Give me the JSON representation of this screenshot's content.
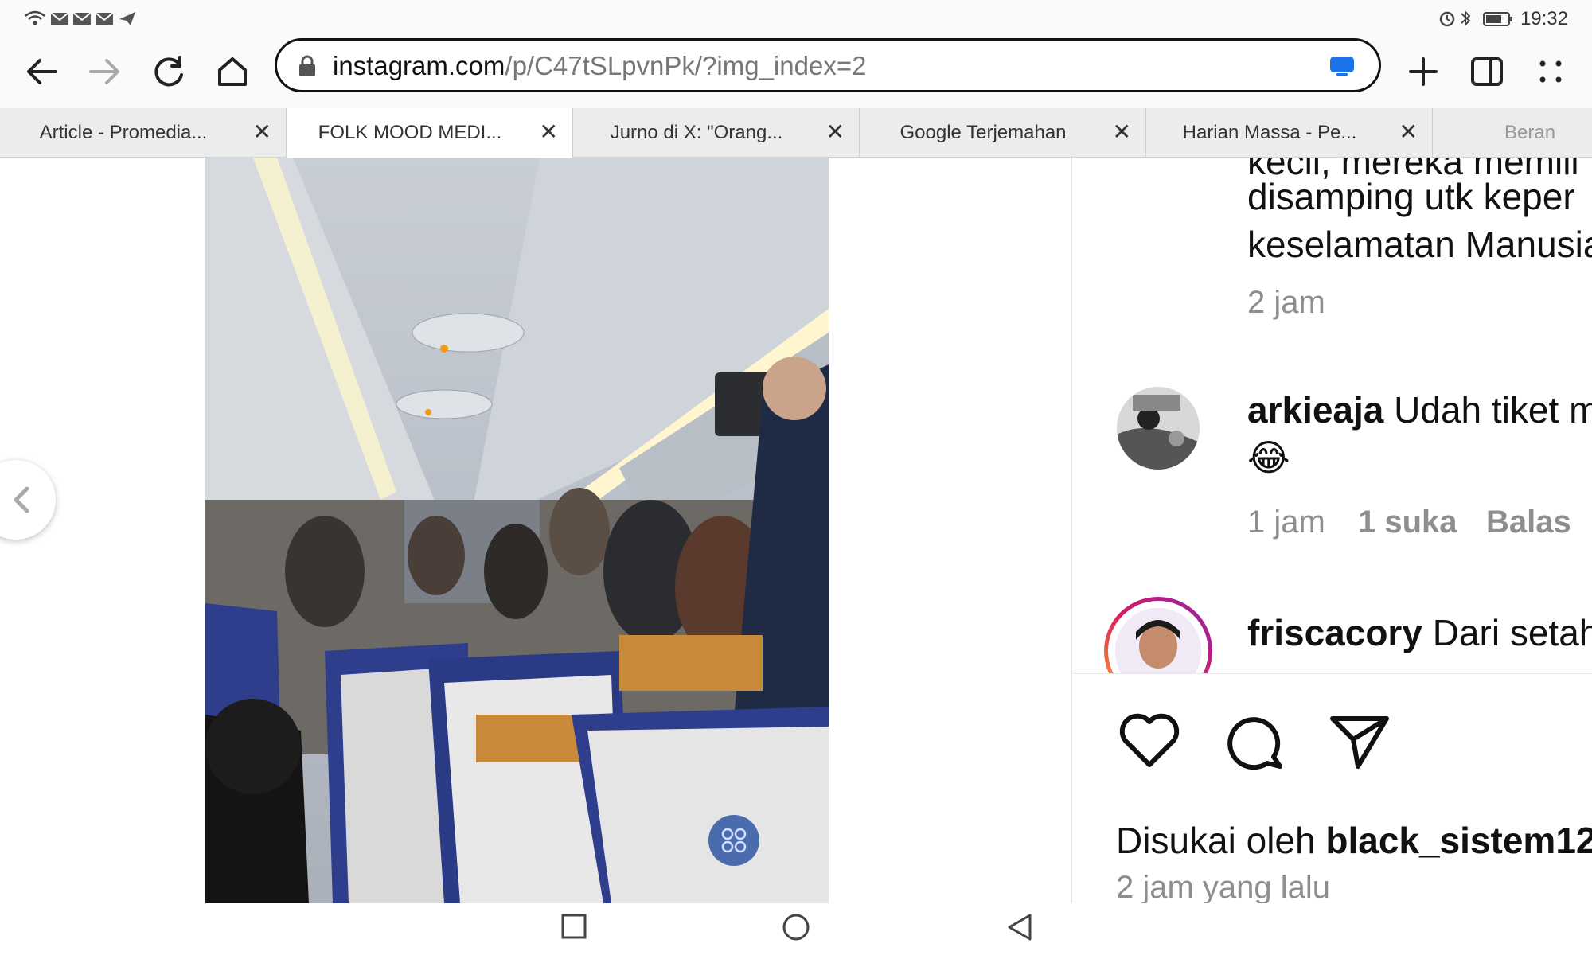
{
  "status": {
    "time": "19:32",
    "left_icons": [
      "wifi-icon",
      "mail-icon",
      "mail-icon",
      "mail-icon",
      "telegram-icon"
    ],
    "right_icons": [
      "alarm-icon",
      "bluetooth-icon",
      "battery-icon"
    ]
  },
  "toolbar": {
    "url_host": "instagram.com",
    "url_path": "/p/C47tSLpvnPk/?img_index=2",
    "buttons": [
      "back-icon",
      "forward-icon",
      "reload-icon",
      "home-icon",
      "new-tab-icon",
      "tab-switcher-icon",
      "menu-icon"
    ]
  },
  "tabs": [
    {
      "title": "Article - Promedia...",
      "close": "✕"
    },
    {
      "title": "FOLK MOOD MEDI...",
      "close": "✕"
    },
    {
      "title": "Jurno di X: \"Orang...",
      "close": "✕"
    },
    {
      "title": "Google Terjemahan",
      "close": "✕"
    },
    {
      "title": "Harian Massa - Pe...",
      "close": "✕"
    },
    {
      "title": "Beran",
      "close": ""
    }
  ],
  "comments": {
    "c1": {
      "line1": "kecil, mereka memili",
      "line2": "disamping utk keper",
      "line3": "keselamatan Manusia",
      "time": "2 jam"
    },
    "c2": {
      "username": "arkieaja",
      "text": "Udah tiket m",
      "emoji": "😂",
      "time": "1 jam",
      "likes": "1 suka",
      "reply": "Balas"
    },
    "c3": {
      "username": "friscacory",
      "text": "Dari setah"
    }
  },
  "post": {
    "liked_prefix": "Disukai oleh ",
    "liked_user": "black_sistem12",
    "time_ago": "2 jam yang lalu"
  },
  "colors": {
    "accent_blue": "#1a73e8",
    "story_ring_start": "#f9a825",
    "story_ring_end": "#d81b60"
  }
}
